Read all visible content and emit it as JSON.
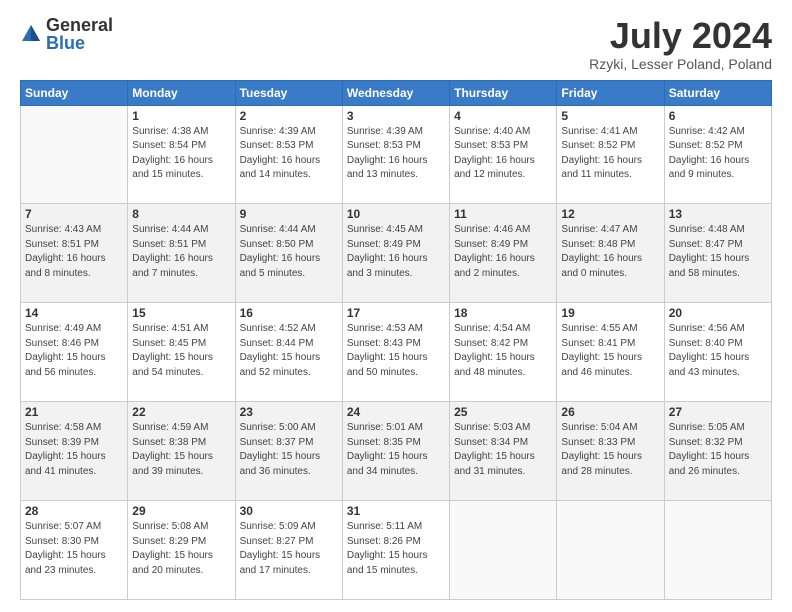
{
  "header": {
    "logo_general": "General",
    "logo_blue": "Blue",
    "month_title": "July 2024",
    "location": "Rzyki, Lesser Poland, Poland"
  },
  "days_of_week": [
    "Sunday",
    "Monday",
    "Tuesday",
    "Wednesday",
    "Thursday",
    "Friday",
    "Saturday"
  ],
  "weeks": [
    [
      {
        "day": "",
        "info": ""
      },
      {
        "day": "1",
        "info": "Sunrise: 4:38 AM\nSunset: 8:54 PM\nDaylight: 16 hours\nand 15 minutes."
      },
      {
        "day": "2",
        "info": "Sunrise: 4:39 AM\nSunset: 8:53 PM\nDaylight: 16 hours\nand 14 minutes."
      },
      {
        "day": "3",
        "info": "Sunrise: 4:39 AM\nSunset: 8:53 PM\nDaylight: 16 hours\nand 13 minutes."
      },
      {
        "day": "4",
        "info": "Sunrise: 4:40 AM\nSunset: 8:53 PM\nDaylight: 16 hours\nand 12 minutes."
      },
      {
        "day": "5",
        "info": "Sunrise: 4:41 AM\nSunset: 8:52 PM\nDaylight: 16 hours\nand 11 minutes."
      },
      {
        "day": "6",
        "info": "Sunrise: 4:42 AM\nSunset: 8:52 PM\nDaylight: 16 hours\nand 9 minutes."
      }
    ],
    [
      {
        "day": "7",
        "info": "Sunrise: 4:43 AM\nSunset: 8:51 PM\nDaylight: 16 hours\nand 8 minutes."
      },
      {
        "day": "8",
        "info": "Sunrise: 4:44 AM\nSunset: 8:51 PM\nDaylight: 16 hours\nand 7 minutes."
      },
      {
        "day": "9",
        "info": "Sunrise: 4:44 AM\nSunset: 8:50 PM\nDaylight: 16 hours\nand 5 minutes."
      },
      {
        "day": "10",
        "info": "Sunrise: 4:45 AM\nSunset: 8:49 PM\nDaylight: 16 hours\nand 3 minutes."
      },
      {
        "day": "11",
        "info": "Sunrise: 4:46 AM\nSunset: 8:49 PM\nDaylight: 16 hours\nand 2 minutes."
      },
      {
        "day": "12",
        "info": "Sunrise: 4:47 AM\nSunset: 8:48 PM\nDaylight: 16 hours\nand 0 minutes."
      },
      {
        "day": "13",
        "info": "Sunrise: 4:48 AM\nSunset: 8:47 PM\nDaylight: 15 hours\nand 58 minutes."
      }
    ],
    [
      {
        "day": "14",
        "info": "Sunrise: 4:49 AM\nSunset: 8:46 PM\nDaylight: 15 hours\nand 56 minutes."
      },
      {
        "day": "15",
        "info": "Sunrise: 4:51 AM\nSunset: 8:45 PM\nDaylight: 15 hours\nand 54 minutes."
      },
      {
        "day": "16",
        "info": "Sunrise: 4:52 AM\nSunset: 8:44 PM\nDaylight: 15 hours\nand 52 minutes."
      },
      {
        "day": "17",
        "info": "Sunrise: 4:53 AM\nSunset: 8:43 PM\nDaylight: 15 hours\nand 50 minutes."
      },
      {
        "day": "18",
        "info": "Sunrise: 4:54 AM\nSunset: 8:42 PM\nDaylight: 15 hours\nand 48 minutes."
      },
      {
        "day": "19",
        "info": "Sunrise: 4:55 AM\nSunset: 8:41 PM\nDaylight: 15 hours\nand 46 minutes."
      },
      {
        "day": "20",
        "info": "Sunrise: 4:56 AM\nSunset: 8:40 PM\nDaylight: 15 hours\nand 43 minutes."
      }
    ],
    [
      {
        "day": "21",
        "info": "Sunrise: 4:58 AM\nSunset: 8:39 PM\nDaylight: 15 hours\nand 41 minutes."
      },
      {
        "day": "22",
        "info": "Sunrise: 4:59 AM\nSunset: 8:38 PM\nDaylight: 15 hours\nand 39 minutes."
      },
      {
        "day": "23",
        "info": "Sunrise: 5:00 AM\nSunset: 8:37 PM\nDaylight: 15 hours\nand 36 minutes."
      },
      {
        "day": "24",
        "info": "Sunrise: 5:01 AM\nSunset: 8:35 PM\nDaylight: 15 hours\nand 34 minutes."
      },
      {
        "day": "25",
        "info": "Sunrise: 5:03 AM\nSunset: 8:34 PM\nDaylight: 15 hours\nand 31 minutes."
      },
      {
        "day": "26",
        "info": "Sunrise: 5:04 AM\nSunset: 8:33 PM\nDaylight: 15 hours\nand 28 minutes."
      },
      {
        "day": "27",
        "info": "Sunrise: 5:05 AM\nSunset: 8:32 PM\nDaylight: 15 hours\nand 26 minutes."
      }
    ],
    [
      {
        "day": "28",
        "info": "Sunrise: 5:07 AM\nSunset: 8:30 PM\nDaylight: 15 hours\nand 23 minutes."
      },
      {
        "day": "29",
        "info": "Sunrise: 5:08 AM\nSunset: 8:29 PM\nDaylight: 15 hours\nand 20 minutes."
      },
      {
        "day": "30",
        "info": "Sunrise: 5:09 AM\nSunset: 8:27 PM\nDaylight: 15 hours\nand 17 minutes."
      },
      {
        "day": "31",
        "info": "Sunrise: 5:11 AM\nSunset: 8:26 PM\nDaylight: 15 hours\nand 15 minutes."
      },
      {
        "day": "",
        "info": ""
      },
      {
        "day": "",
        "info": ""
      },
      {
        "day": "",
        "info": ""
      }
    ]
  ]
}
